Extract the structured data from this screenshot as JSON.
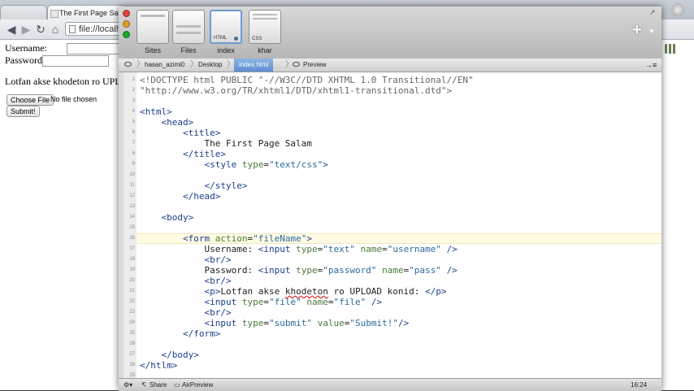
{
  "browser": {
    "tab_title": "The First Page Salam",
    "url": "file://localh",
    "back_icon": "back-arrow-icon",
    "forward_icon": "forward-arrow-icon",
    "reload_icon": "reload-icon",
    "home_icon": "home-icon",
    "page": {
      "username_label": "Username:",
      "password_label": "Password:",
      "paragraph": "Lotfan akse khodeton ro UPLOA",
      "choose_file": "Choose File",
      "no_file": "No file chosen",
      "submit": "Submit!"
    }
  },
  "editor": {
    "sidebar_items": [
      {
        "label": "Sites",
        "tag": ""
      },
      {
        "label": "Files",
        "tag": ""
      },
      {
        "label": "index",
        "tag": "HTML"
      },
      {
        "label": "khar",
        "tag": "CSS"
      }
    ],
    "path": {
      "segments": [
        "hasan_azimi0",
        "Desktop",
        "index.html",
        "Preview"
      ],
      "active_index": 2
    },
    "line_numbers": [
      "1",
      "2",
      "3",
      "4",
      "5",
      "6",
      "7",
      "8",
      "9",
      "10",
      "11",
      "12",
      "13",
      "14",
      "15",
      "16",
      "17",
      "18",
      "19",
      "20",
      "21",
      "22",
      "23",
      "24",
      "25",
      "26",
      "27",
      "28",
      "29"
    ],
    "code_lines": [
      "<!DOCTYPE html PUBLIC \"-//W3C//DTD XHTML 1.0 Transitional//EN\"",
      "\"http://www.w3.org/TR/xhtml1/DTD/xhtml1-transitional.dtd\">",
      "",
      "<html>",
      "    <head>",
      "        <title>",
      "            The First Page Salam",
      "        </title>",
      "            <style type=\"text/css\">",
      "",
      "            </style>",
      "        </head>",
      "",
      "    <body>",
      "",
      "        <form action=\"fileName\">",
      "            Username: <input type=\"text\" name=\"username\" />",
      "            <br/>",
      "            Password: <input type=\"password\" name=\"pass\" />",
      "            <br/>",
      "            <p>Lotfan akse khodeton ro UPLOAD konid: </p>",
      "            <input type=\"file\" name=\"file\" />",
      "            <br/>",
      "            <input type=\"submit\" value=\"Submit!\"/>",
      "        </form>",
      "",
      "    </body>",
      "</htlm>",
      ""
    ],
    "highlighted_line": 16,
    "status": {
      "share": "Share",
      "airpreview": "AirPreview",
      "cursor": "16:24"
    }
  }
}
